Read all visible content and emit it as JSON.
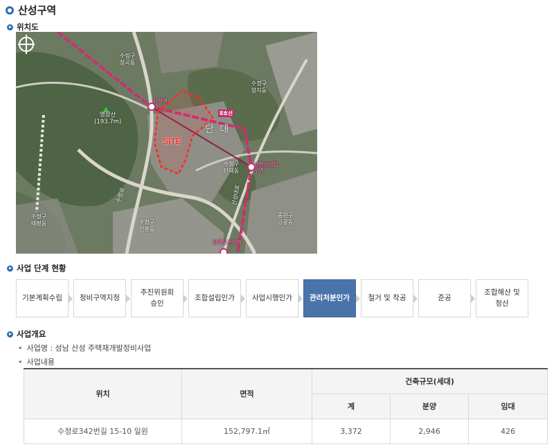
{
  "title": "산성구역",
  "location_section": "위치도",
  "map": {
    "site_label": "SITE",
    "labels": {
      "mountain": "영장산",
      "mountain_height": "(193.7m)",
      "station1": "산성역",
      "station2": "남한산성입구역",
      "station3": "단대오거리역",
      "line": "8호선",
      "district": "단 대",
      "road1": "수정로",
      "road2": "산성대로",
      "dong1": "수정구\n신흥동",
      "dong2": "수정구\n양지동",
      "dong3": "수정구\n태평동",
      "dong4": "중원구\n금광동",
      "dong5": "수정구\n단대동",
      "dong6": "수정구\n창곡동"
    }
  },
  "steps_section": "사업 단계 현황",
  "steps": [
    "기본계획수립",
    "정비구역지정",
    "추진위원회\n승인",
    "조합설립인가",
    "사업시행인가",
    "관리처분인가",
    "철거 및 착공",
    "준공",
    "조합해산 및\n청산"
  ],
  "active_step": 5,
  "overview_section": "사업개요",
  "project_name": "사업명 : 성남 산성 주택재개발정비사업",
  "project_content": "사업내용",
  "table": {
    "headers": {
      "location": "위치",
      "area": "면적",
      "scale": "건축규모(세대)",
      "total": "계",
      "sale": "분양",
      "rent": "임대"
    },
    "row": {
      "location": "수정로342번길 15-10 일원",
      "area": "152,797.1㎡",
      "total": "3,372",
      "sale": "2,946",
      "rent": "426"
    }
  }
}
